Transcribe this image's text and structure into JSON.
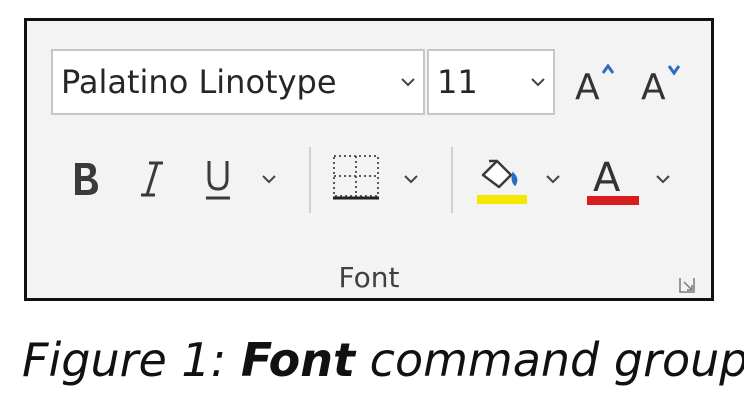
{
  "ribbon": {
    "font_name": "Palatino Linotype",
    "font_size": "11",
    "group_label": "Font"
  },
  "colors": {
    "highlight": "#f5e800",
    "font_color": "#d71e1e",
    "border": "#111111",
    "ribbon_bg": "#f3f3f3"
  },
  "icons": [
    "chevron-down-icon",
    "increase-font-size-icon",
    "decrease-font-size-icon",
    "bold-icon",
    "italic-icon",
    "underline-icon",
    "borders-icon",
    "fill-color-icon",
    "font-color-icon",
    "dialog-launcher-icon"
  ],
  "caption": {
    "prefix": "Figure 1: ",
    "bold": "Font",
    "suffix": " command group"
  }
}
